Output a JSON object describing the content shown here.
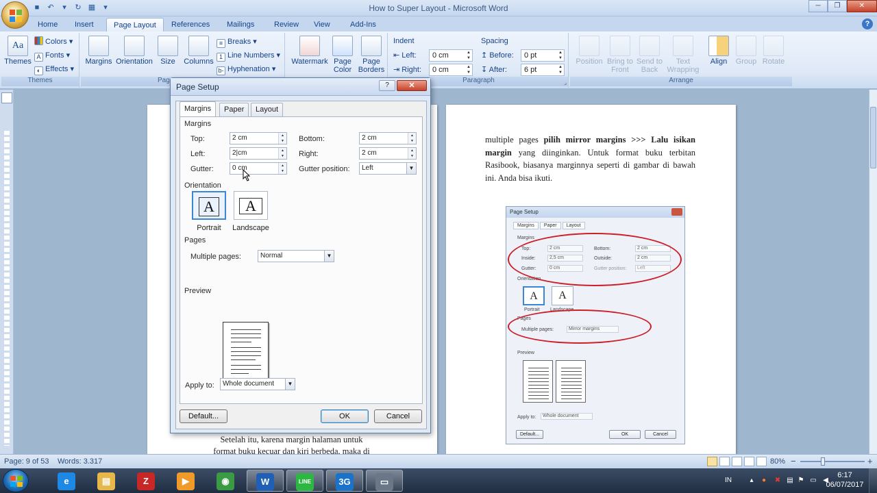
{
  "window": {
    "title": "How to Super Layout - Microsoft Word",
    "minimize": "─",
    "restore": "❐",
    "close": "✕"
  },
  "tabs": [
    "Home",
    "Insert",
    "Page Layout",
    "References",
    "Mailings",
    "Review",
    "View",
    "Add-Ins"
  ],
  "ribbon": {
    "themes": {
      "label": "Themes",
      "big_label": "Themes",
      "colors": "Colors",
      "fonts": "Fonts",
      "effects": "Effects"
    },
    "page_setup": {
      "margins": "Margins",
      "orientation": "Orientation",
      "size": "Size",
      "columns": "Columns",
      "breaks": "Breaks",
      "line_numbers": "Line Numbers",
      "hyphenation": "Hyphenation",
      "label_partial": "Pag"
    },
    "page_background": {
      "watermark": "Watermark",
      "page_color": "Page Color",
      "page_borders": "Page Borders"
    },
    "paragraph": {
      "label": "Paragraph",
      "indent_title": "Indent",
      "spacing_title": "Spacing",
      "left_label": "Left:",
      "left_value": "0 cm",
      "right_label": "Right:",
      "right_value": "0 cm",
      "before_label": "Before:",
      "before_value": "0 pt",
      "after_label": "After:",
      "after_value": "6 pt"
    },
    "arrange": {
      "label": "Arrange",
      "position": "Position",
      "bring_to_front": "Bring to Front",
      "send_to_back": "Send to Back",
      "text_wrapping": "Text Wrapping",
      "align": "Align",
      "group": "Group",
      "rotate": "Rotate"
    }
  },
  "document": {
    "right_para_html_parts": [
      {
        "t": "multiple pages ",
        "b": false
      },
      {
        "t": "pilih mirror margins >>> Lalu isikan margin",
        "b": true
      },
      {
        "t": " yang diinginkan. Untuk format buku terbitan Rasibook, biasanya marginnya seperti di gambar di bawah ini. Anda bisa ikuti.",
        "b": false
      }
    ],
    "left_para_line1": "Setelah itu, karena margin halaman untuk",
    "left_para_line2": "format buku kecuar dan kiri berbeda, maka di",
    "embedded": {
      "title": "Page Setup",
      "tabs": [
        "Margins",
        "Paper",
        "Layout"
      ],
      "margins_label": "Margins",
      "top_label": "Top:",
      "top_value": "2 cm",
      "bottom_label": "Bottom:",
      "bottom_value": "2 cm",
      "inside_label": "Inside:",
      "inside_value": "2,5 cm",
      "outside_label": "Outside:",
      "outside_value": "2 cm",
      "gutter_label": "Gutter:",
      "gutter_value": "0 cm",
      "gutter_pos_label": "Gutter position:",
      "gutter_pos_value": "Left",
      "orientation_label": "Orientation",
      "portrait": "Portrait",
      "landscape": "Landscape",
      "pages_label": "Pages",
      "multiple_pages_label": "Multiple pages:",
      "multiple_pages_value": "Mirror margins",
      "preview_label": "Preview",
      "apply_label": "Apply to:",
      "apply_value": "Whole document",
      "default_btn": "Default...",
      "ok_btn": "OK",
      "cancel_btn": "Cancel"
    }
  },
  "dialog": {
    "title": "Page Setup",
    "help": "?",
    "close": "✕",
    "tabs": [
      "Margins",
      "Paper",
      "Layout"
    ],
    "margins_section": "Margins",
    "top_label": "Top:",
    "top_value": "2 cm",
    "bottom_label": "Bottom:",
    "bottom_value": "2 cm",
    "left_label": "Left:",
    "left_value": "2|cm",
    "right_label": "Right:",
    "right_value": "2 cm",
    "gutter_label": "Gutter:",
    "gutter_value": "0 cm",
    "gutter_pos_label": "Gutter position:",
    "gutter_pos_value": "Left",
    "orientation_section": "Orientation",
    "portrait": "Portrait",
    "landscape": "Landscape",
    "pages_section": "Pages",
    "multiple_pages_label": "Multiple pages:",
    "multiple_pages_value": "Normal",
    "preview_section": "Preview",
    "apply_label": "Apply to:",
    "apply_value": "Whole document",
    "default_btn": "Default...",
    "ok_btn": "OK",
    "cancel_btn": "Cancel"
  },
  "statusbar": {
    "page": "Page: 9 of 53",
    "words": "Words: 3.317",
    "zoom": "80%",
    "zoom_fraction": 0.35,
    "zoom_out": "−",
    "zoom_in": "+"
  },
  "taskbar": {
    "apps": [
      {
        "name": "ie",
        "glyph": "e",
        "color": "#1e88e5"
      },
      {
        "name": "explorer",
        "glyph": "▤",
        "color": "#e6b84a"
      },
      {
        "name": "filezilla",
        "glyph": "Z",
        "color": "#c62828"
      },
      {
        "name": "media-player",
        "glyph": "▶",
        "color": "#f09a2a"
      },
      {
        "name": "chrome",
        "glyph": "◉",
        "color": "#3b9b44"
      },
      {
        "name": "word",
        "glyph": "W",
        "color": "#1f5fb5"
      },
      {
        "name": "line",
        "glyph": "LINE",
        "color": "#2db742"
      },
      {
        "name": "3g-modem",
        "glyph": "3G",
        "color": "#1b73c9"
      },
      {
        "name": "recorder",
        "glyph": "▭",
        "color": "#6b7788"
      }
    ],
    "language": "IN",
    "time": "6:17",
    "date": "06/07/2017"
  }
}
